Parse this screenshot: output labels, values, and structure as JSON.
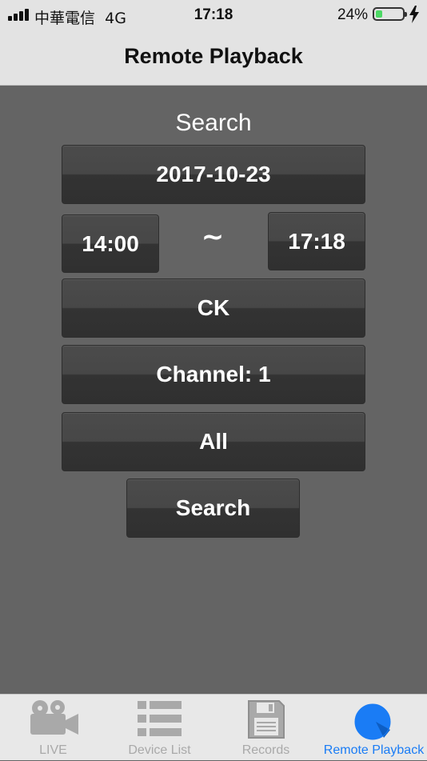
{
  "status_bar": {
    "carrier": "中華電信",
    "network": "4G",
    "time": "17:18",
    "battery_percent": "24%",
    "battery_level": 0.24,
    "battery_color": "#4cd964"
  },
  "nav": {
    "title": "Remote Playback"
  },
  "form": {
    "section_title": "Search",
    "date": "2017-10-23",
    "start_time": "14:00",
    "range_separator": "~",
    "end_time": "17:18",
    "device": "CK",
    "channel": "Channel:  1",
    "record_type": "All",
    "search_label": "Search"
  },
  "tabs": [
    {
      "label": "LIVE",
      "icon": "video-camera-icon",
      "active": false
    },
    {
      "label": "Device List",
      "icon": "list-icon",
      "active": false
    },
    {
      "label": "Records",
      "icon": "floppy-disk-icon",
      "active": false
    },
    {
      "label": "Remote Playback",
      "icon": "playback-icon",
      "active": true
    }
  ],
  "colors": {
    "background": "#646464",
    "button": "#3d3d3d",
    "accent": "#1a7cf5",
    "inactive_tab": "#a9a9a9"
  }
}
